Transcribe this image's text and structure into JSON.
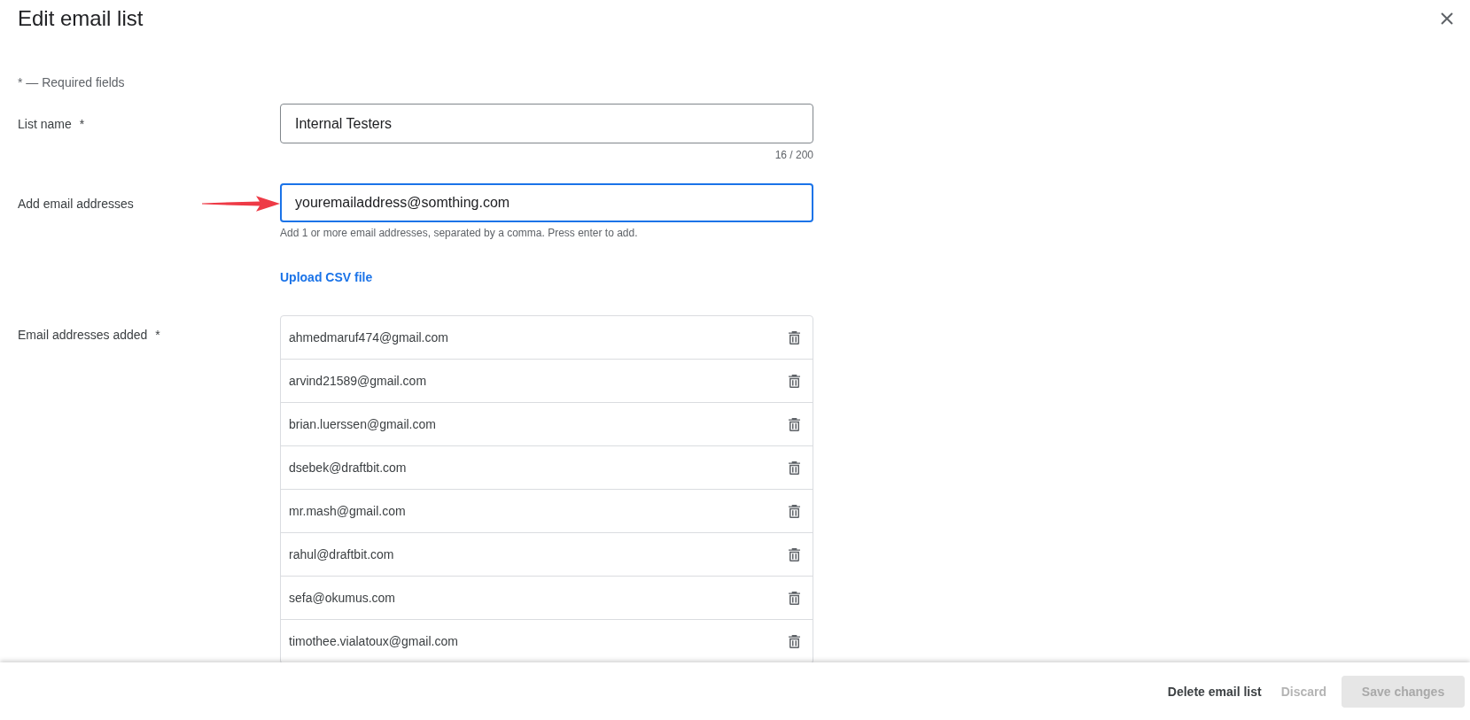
{
  "dialog": {
    "title": "Edit email list"
  },
  "required_note": "* — Required fields",
  "form": [
    {
      "kind": "text_field",
      "label": "List name",
      "required_mark": "*",
      "value": "Internal Testers",
      "counter": "16 / 200",
      "focused": false
    },
    {
      "kind": "text_field",
      "label": "Add email addresses",
      "value": "youremailaddress@somthing.com",
      "helper": "Add 1 or more email addresses, separated by a comma. Press enter to add.",
      "focused": true,
      "arrow_pointer": true
    },
    {
      "kind": "link",
      "text": "Upload CSV file"
    },
    {
      "kind": "email_list",
      "label": "Email addresses added",
      "required_mark": "*",
      "items": [
        {
          "email": "ahmedmaruf474@gmail.com"
        },
        {
          "email": "arvind21589@gmail.com"
        },
        {
          "email": "brian.luerssen@gmail.com"
        },
        {
          "email": "dsebek@draftbit.com"
        },
        {
          "email": "mr.mash@gmail.com"
        },
        {
          "email": "rahul@draftbit.com"
        },
        {
          "email": "sefa@okumus.com"
        },
        {
          "email": "timothee.vialatoux@gmail.com"
        }
      ]
    }
  ],
  "footer": {
    "buttons": [
      {
        "label": "Delete email list",
        "kind": "text",
        "disabled": false
      },
      {
        "label": "Discard",
        "kind": "text",
        "disabled": true
      },
      {
        "label": "Save changes",
        "kind": "filled",
        "disabled": true
      }
    ]
  }
}
